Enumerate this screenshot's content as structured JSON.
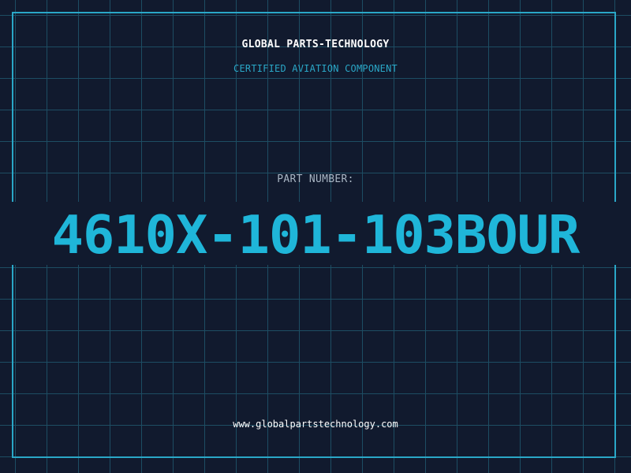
{
  "header": {
    "company": "GLOBAL PARTS-TECHNOLOGY",
    "subtitle": "CERTIFIED AVIATION COMPONENT"
  },
  "part": {
    "label": "PART NUMBER:",
    "number": "4610X-101-103BOUR"
  },
  "footer": {
    "website": "www.globalpartstechnology.com"
  },
  "colors": {
    "background": "#111a2e",
    "grid": "#1d4d63",
    "accent": "#1fb6d9",
    "border": "#2aa7c7",
    "text": "#ffffff",
    "muted": "#a9b6c4"
  }
}
